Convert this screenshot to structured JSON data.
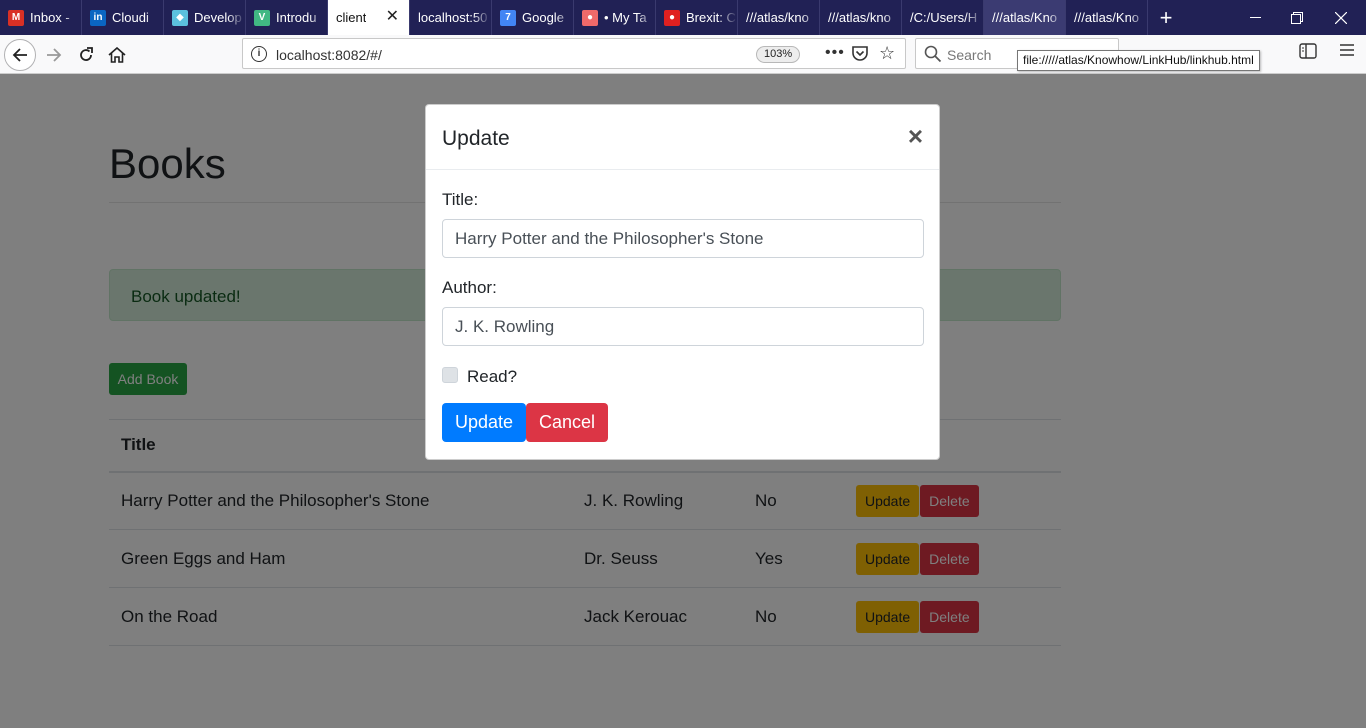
{
  "browser": {
    "tabs": [
      {
        "label": "Inbox -",
        "icon": "gmail-icon",
        "color": "#d93025",
        "glyph": "M"
      },
      {
        "label": "Cloudi",
        "icon": "linkedin-icon",
        "color": "#0a66c2",
        "glyph": "in"
      },
      {
        "label": "Develop",
        "icon": "cube-icon",
        "color": "#5bc0de",
        "glyph": "◆"
      },
      {
        "label": "Introdu",
        "icon": "vue-icon",
        "color": "#41b883",
        "glyph": "V"
      },
      {
        "label": "client",
        "icon": "",
        "color": "",
        "glyph": "",
        "active": true
      },
      {
        "label": "localhost:50",
        "icon": "",
        "color": "",
        "glyph": ""
      },
      {
        "label": "Google",
        "icon": "google-calendar-icon",
        "color": "#4285f4",
        "glyph": "7"
      },
      {
        "label": "• My Ta",
        "icon": "asana-icon",
        "color": "#f06a6a",
        "glyph": "●"
      },
      {
        "label": "Brexit: C",
        "icon": "record-icon",
        "color": "#e02020",
        "glyph": "●"
      },
      {
        "label": "///atlas/kno",
        "icon": "",
        "color": "",
        "glyph": ""
      },
      {
        "label": "///atlas/kno",
        "icon": "",
        "color": "",
        "glyph": ""
      },
      {
        "label": "/C:/Users/H",
        "icon": "",
        "color": "",
        "glyph": ""
      },
      {
        "label": "///atlas/Kno",
        "icon": "",
        "color": "",
        "glyph": "",
        "hover": true
      },
      {
        "label": "///atlas/Kno",
        "icon": "",
        "color": "",
        "glyph": ""
      }
    ],
    "tab_close": "✕",
    "new_tab": "+",
    "url": "localhost:8082/#/",
    "zoom": "103%",
    "search_placeholder": "Search",
    "tooltip": "file://///atlas/Knowhow/LinkHub/linkhub.html"
  },
  "page": {
    "heading": "Books",
    "alert": "Book updated!",
    "add_button": "Add Book",
    "table": {
      "headers": [
        "Title",
        "",
        "",
        ""
      ],
      "rows": [
        {
          "title": "Harry Potter and the Philosopher's Stone",
          "author": "J. K. Rowling",
          "read": "No"
        },
        {
          "title": "Green Eggs and Ham",
          "author": "Dr. Seuss",
          "read": "Yes"
        },
        {
          "title": "On the Road",
          "author": "Jack Kerouac",
          "read": "No"
        }
      ],
      "update_label": "Update",
      "delete_label": "Delete"
    }
  },
  "modal": {
    "title": "Update",
    "close": "×",
    "title_label": "Title:",
    "title_value": "Harry Potter and the Philosopher's Stone",
    "author_label": "Author:",
    "author_value": "J. K. Rowling",
    "read_label": "Read?",
    "read_checked": false,
    "update_button": "Update",
    "cancel_button": "Cancel"
  }
}
